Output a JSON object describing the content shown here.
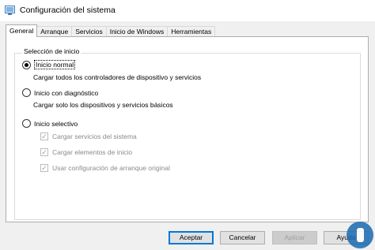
{
  "window": {
    "title": "Configuración del sistema",
    "icon": "system-config-icon"
  },
  "tabs": [
    {
      "label": "General",
      "active": true
    },
    {
      "label": "Arranque",
      "active": false
    },
    {
      "label": "Servicios",
      "active": false
    },
    {
      "label": "Inicio de Windows",
      "active": false
    },
    {
      "label": "Herramientas",
      "active": false
    }
  ],
  "startup_selection": {
    "group_label": "Selección de inicio",
    "options": [
      {
        "label": "Inicio normal",
        "description": "Cargar todos los controladores de dispositivo y servicios",
        "selected": true
      },
      {
        "label": "Inicio con diagnóstico",
        "description": "Cargar solo los dispositivos y servicios básicos",
        "selected": false
      },
      {
        "label": "Inicio selectivo",
        "selected": false
      }
    ],
    "selective_checks": [
      {
        "label": "Cargar servicios del sistema",
        "checked": true,
        "enabled": false
      },
      {
        "label": "Cargar elementos de inicio",
        "checked": true,
        "enabled": false
      },
      {
        "label": "Usar configuración de arranque original",
        "checked": true,
        "enabled": false
      }
    ]
  },
  "buttons": {
    "accept": "Aceptar",
    "cancel": "Cancelar",
    "apply": "Aplicar",
    "help": "Ayuda"
  },
  "colors": {
    "accent": "#0078d7",
    "watermark": "#1a6bb0"
  }
}
